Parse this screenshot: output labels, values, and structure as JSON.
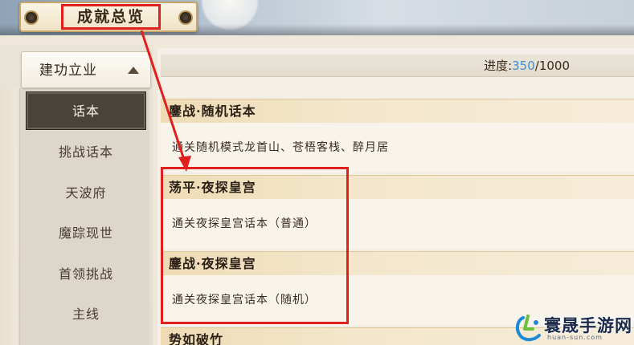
{
  "header": {
    "title": "成就总览"
  },
  "sidebar": {
    "category": "建功立业",
    "items": [
      {
        "label": "话本",
        "active": true
      },
      {
        "label": "挑战话本",
        "active": false
      },
      {
        "label": "天波府",
        "active": false
      },
      {
        "label": "魔踪现世",
        "active": false
      },
      {
        "label": "首领挑战",
        "active": false
      },
      {
        "label": "主线",
        "active": false
      }
    ]
  },
  "progress": {
    "label": "进度:",
    "current": "350",
    "total": "/1000"
  },
  "achievements": [
    {
      "title": "鏖战·随机话本",
      "description": "通关随机模式龙首山、苍梧客栈、醉月居"
    },
    {
      "title": "荡平·夜探皇宫",
      "description": "通关夜探皇宫话本（普通）"
    },
    {
      "title": "鏖战·夜探皇宫",
      "description": "通关夜探皇宫话本（随机）"
    },
    {
      "title": "势如破竹",
      "description": ""
    }
  ],
  "watermark": {
    "title": "寰晟手游网",
    "url": "huan-sun.com"
  },
  "colors": {
    "highlight_red": "#e0201c",
    "progress_blue": "#3c8fd6",
    "active_tab": "#4a433c"
  }
}
